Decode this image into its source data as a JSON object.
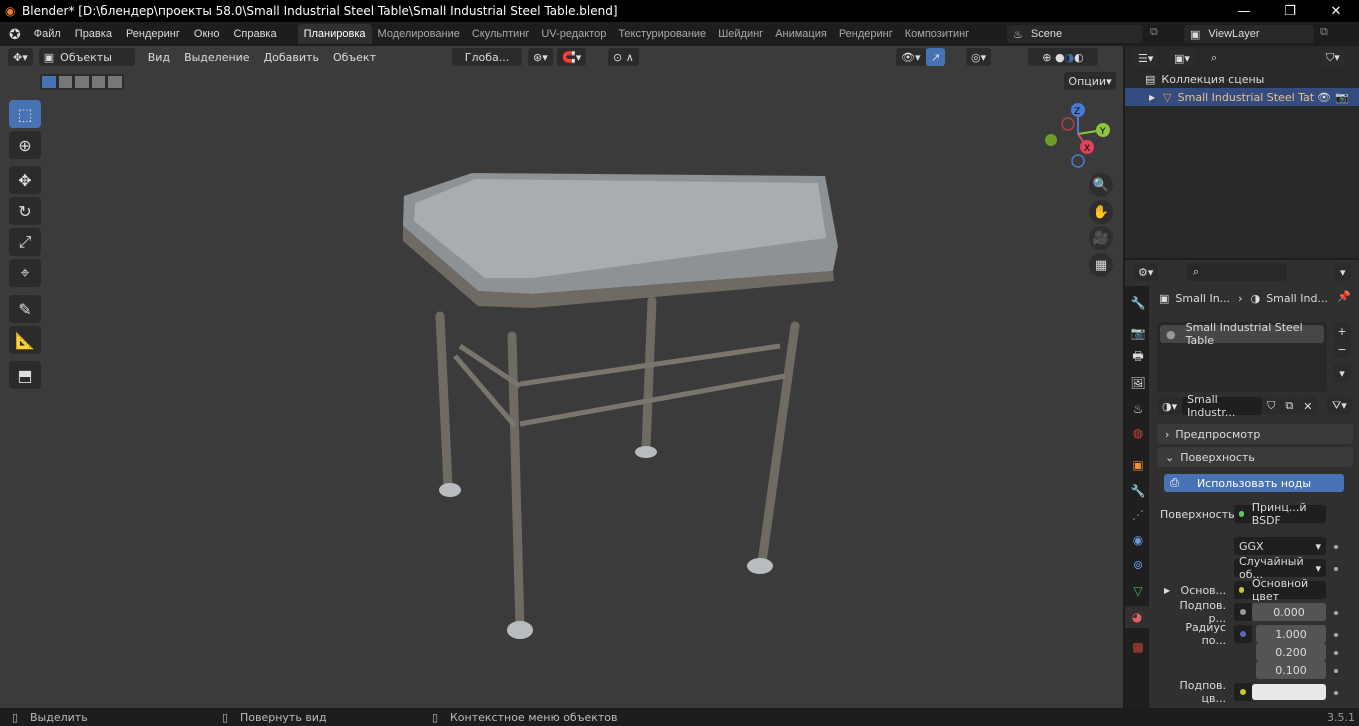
{
  "title": "Blender* [D:\\блендер\\проекты 58.0\\Small Industrial Steel Table\\Small Industrial Steel Table.blend]",
  "menu": [
    "Файл",
    "Правка",
    "Рендеринг",
    "Окно",
    "Справка"
  ],
  "workspaces": [
    "Планировка",
    "Моделирование",
    "Скульптинг",
    "UV-редактор",
    "Текстурирование",
    "Шейдинг",
    "Анимация",
    "Рендеринг",
    "Композитинг"
  ],
  "active_workspace": "Планировка",
  "scene": "Scene",
  "view_layer": "ViewLayer",
  "viewport": {
    "mode": "Объекты",
    "menus": [
      "Вид",
      "Выделение",
      "Добавить",
      "Объект"
    ],
    "orientation": "Глоба...",
    "options": "Опции",
    "gizmo": {
      "x": "X",
      "y": "Y",
      "z": "Z"
    }
  },
  "outliner": {
    "collection": "Коллекция сцены",
    "object": "Small Industrial Steel Tat"
  },
  "properties": {
    "breadcrumb": [
      "Small In...",
      "Small Ind..."
    ],
    "material_slot": "Small Industrial Steel Table",
    "material_name": "Small Industr...",
    "panels": {
      "preview": "Предпросмотр",
      "surface": "Поверхность"
    },
    "use_nodes": "Использовать ноды",
    "surface_label": "Поверхность",
    "surface_value": "Принц...й BSDF",
    "distribution": "GGX",
    "subsurface_method": "Случайный об...",
    "base_label": "Основ...",
    "base_value": "Основной цвет",
    "subsurf_label": "Подпов. р...",
    "subsurf_value": "0.000",
    "radius_label": "Радиус по...",
    "radius": [
      "1.000",
      "0.200",
      "0.100"
    ],
    "subsurf_color_label": "Подпов. цв...",
    "colors": {
      "accent": "#4772b3",
      "base_socket": "#c7c729",
      "bsdf_socket": "#63c763",
      "radius_socket": "#6363c7"
    }
  },
  "status": {
    "select": "Выделить",
    "rotate": "Повернуть вид",
    "context": "Контекстное меню объектов",
    "version": "3.5.1"
  }
}
